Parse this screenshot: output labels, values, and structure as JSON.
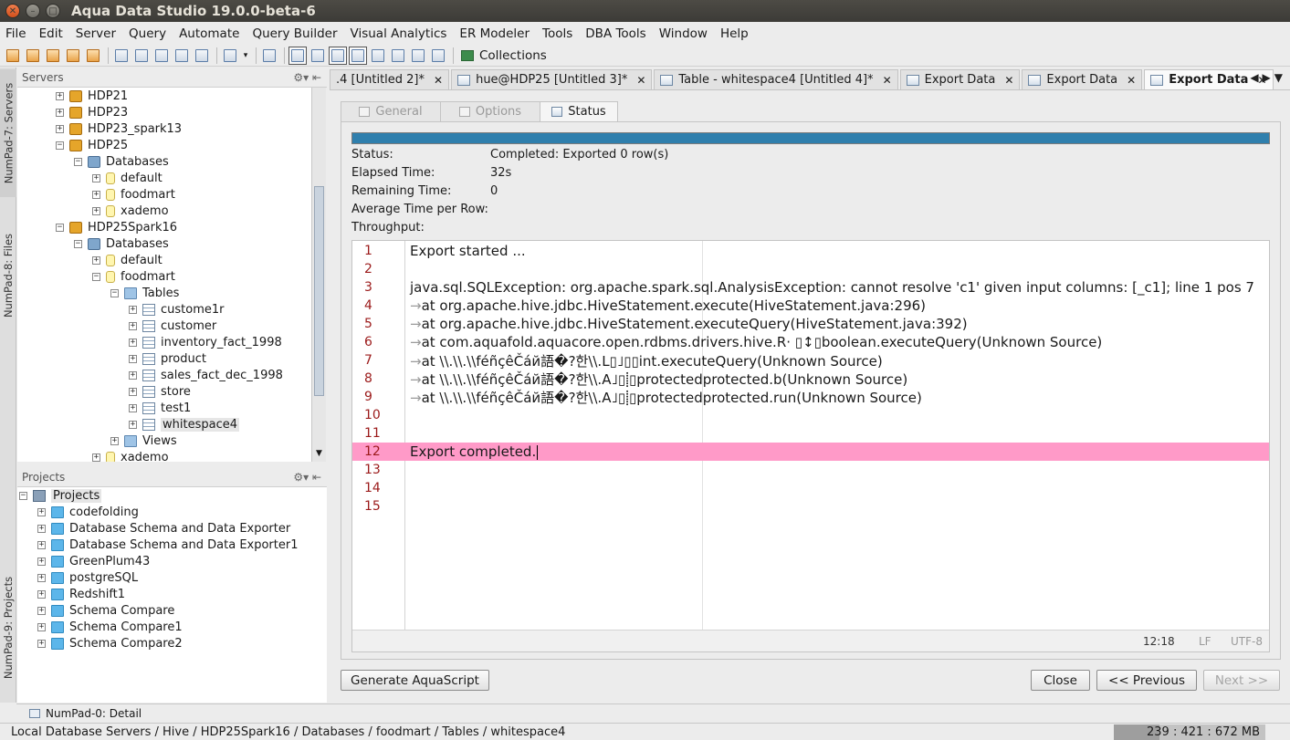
{
  "window": {
    "title": "Aqua Data Studio 19.0.0-beta-6"
  },
  "menu": [
    "File",
    "Edit",
    "Server",
    "Query",
    "Automate",
    "Query Builder",
    "Visual Analytics",
    "ER Modeler",
    "Tools",
    "DBA Tools",
    "Window",
    "Help"
  ],
  "toolbar": {
    "collections_label": "Collections"
  },
  "side_tabs": {
    "servers": "NumPad-7: Servers",
    "files": "NumPad-8: Files",
    "projects": "NumPad-9: Projects"
  },
  "servers_panel": {
    "title": "Servers",
    "items": [
      "HDP21",
      "HDP23",
      "HDP23_spark13",
      "HDP25",
      "Databases",
      "default",
      "foodmart",
      "xademo",
      "HDP25Spark16",
      "Databases",
      "default",
      "foodmart",
      "Tables",
      "custome1r",
      "customer",
      "inventory_fact_1998",
      "product",
      "sales_fact_dec_1998",
      "store",
      "test1",
      "whitespace4",
      "Views",
      "xademo"
    ]
  },
  "projects_panel": {
    "title": "Projects",
    "items": [
      "Projects",
      "codefolding",
      "Database Schema and Data Exporter",
      "Database Schema and Data Exporter1",
      "GreenPlum43",
      "postgreSQL",
      "Redshift1",
      "Schema Compare",
      "Schema Compare1",
      "Schema Compare2"
    ]
  },
  "editor_tabs": [
    {
      "label": ".4 [Untitled 2]*",
      "active": false
    },
    {
      "label": "hue@HDP25 [Untitled 3]*",
      "active": false
    },
    {
      "label": "Table - whitespace4 [Untitled 4]*",
      "active": false
    },
    {
      "label": "Export Data",
      "active": false
    },
    {
      "label": "Export Data",
      "active": false
    },
    {
      "label": "Export Data",
      "active": true
    }
  ],
  "dialog": {
    "tabs": [
      "General",
      "Options",
      "Status"
    ],
    "progress": 1.0,
    "status": {
      "status_label": "Status:",
      "status_value": "Completed: Exported 0 row(s)",
      "elapsed_label": "Elapsed Time:",
      "elapsed_value": "32s",
      "remaining_label": "Remaining Time:",
      "remaining_value": "0",
      "avg_label": "Average Time per Row:",
      "avg_value": "",
      "throughput_label": "Throughput:",
      "throughput_value": ""
    },
    "log_lines": [
      "Export started ...",
      "",
      "java.sql.SQLException: org.apache.spark.sql.AnalysisException: cannot resolve 'c1' given input columns: [_c1]; line 1 pos 7",
      "at org.apache.hive.jdbc.HiveStatement.execute(HiveStatement.java:296)",
      "at org.apache.hive.jdbc.HiveStatement.executeQuery(HiveStatement.java:392)",
      "at com.aquafold.aquacore.open.rdbms.drivers.hive.R· ▯↕▯boolean.executeQuery(Unknown Source)",
      "at \\\\.\\\\.\\\\féñçêČáй語�?한\\\\.L▯˩▯▯int.executeQuery(Unknown Source)",
      "at \\\\.\\\\.\\\\féñçêČáй語�?한\\\\.A˩▯⸽▯protectedprotected.b(Unknown Source)",
      "at \\\\.\\\\.\\\\féñçêČáй語�?한\\\\.A˩▯⸽▯protectedprotected.run(Unknown Source)",
      "",
      "",
      "Export completed.",
      "",
      "",
      ""
    ],
    "line_numbers": [
      "1",
      "2",
      "3",
      "4",
      "5",
      "6",
      "7",
      "8",
      "9",
      "10",
      "11",
      "12",
      "13",
      "14",
      "15"
    ],
    "editor_status": {
      "position": "12:18",
      "line_ending": "LF",
      "encoding": "UTF-8"
    },
    "buttons": {
      "generate": "Generate AquaScript",
      "close": "Close",
      "previous": "<< Previous",
      "next": "Next >>"
    }
  },
  "detail_tab": "NumPad-0: Detail",
  "statusbar": {
    "path": "Local Database Servers / Hive / HDP25Spark16 / Databases / foodmart / Tables / whitespace4",
    "memory": "239 : 421 : 672 MB"
  },
  "colors": {
    "highlight_line": "#ff9ac8",
    "progress": "#2f7fad",
    "line_number": "#9b1a1a"
  }
}
